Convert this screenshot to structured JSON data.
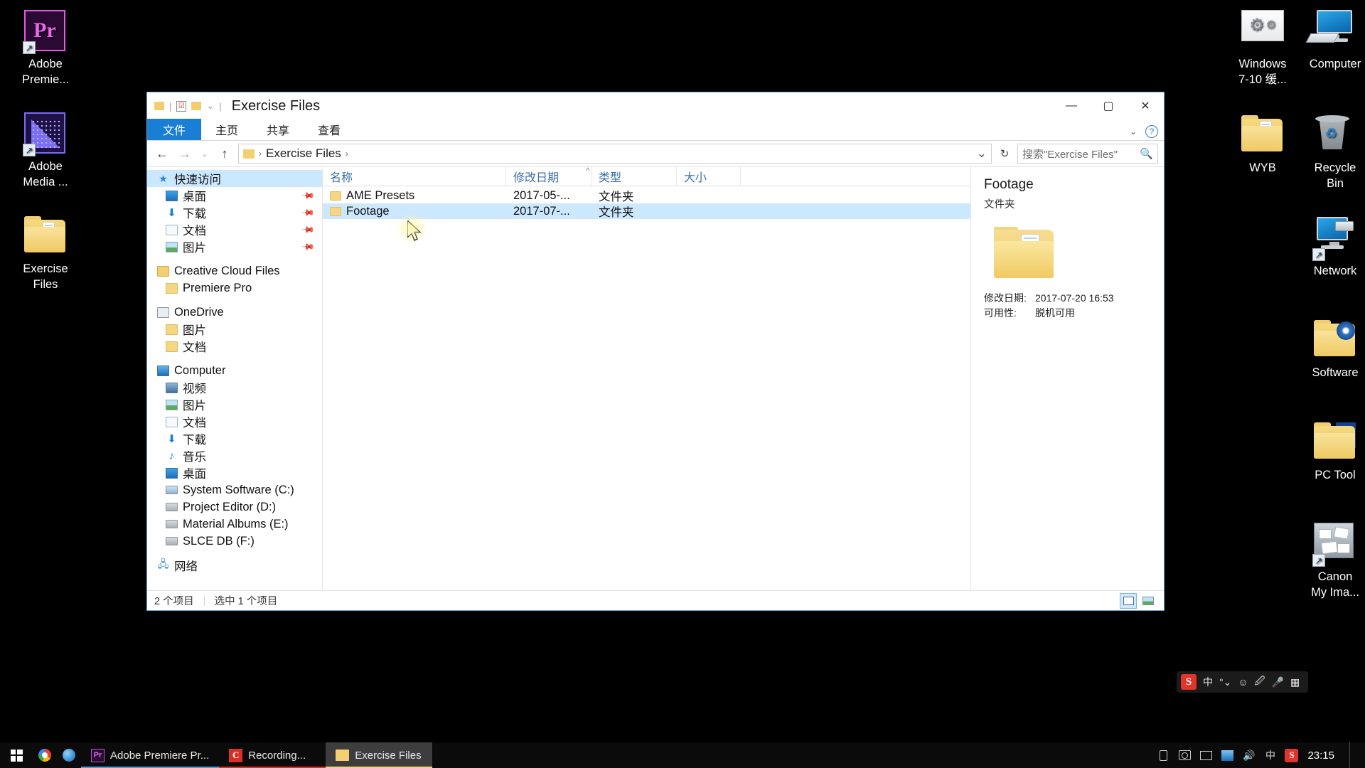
{
  "desktop": {
    "icons_left": [
      {
        "label": "Adobe\nPremie...",
        "icon": "adobe-premiere-icon",
        "shortcut": true
      },
      {
        "label": "Adobe\nMedia ...",
        "icon": "adobe-media-encoder-icon",
        "shortcut": true
      },
      {
        "label": "Exercise\nFiles",
        "icon": "folder-icon",
        "shortcut": false
      }
    ],
    "icons_right": [
      {
        "label": "Windows\n7-10 缓...",
        "icon": "gears-icon",
        "shortcut": false
      },
      {
        "label": "Computer",
        "icon": "computer-icon",
        "shortcut": false
      },
      {
        "label": "WYB",
        "icon": "folder-icon",
        "shortcut": false
      },
      {
        "label": "Recycle\nBin",
        "icon": "recycle-bin-icon",
        "shortcut": false
      },
      {
        "label": "Network",
        "icon": "network-icon",
        "shortcut": true
      },
      {
        "label": "Software",
        "icon": "folder-disc-icon",
        "shortcut": false
      },
      {
        "label": "PC Tool",
        "icon": "folder-s-icon",
        "shortcut": false
      },
      {
        "label": "Canon\nMy Ima...",
        "icon": "canon-my-image-garden-icon",
        "shortcut": true
      }
    ]
  },
  "explorer": {
    "window_title": "Exercise Files",
    "quick_access_toolbar": [
      "folder-icon",
      "properties-icon",
      "new-folder-icon",
      "customize-chevron-icon"
    ],
    "window_buttons": {
      "minimize": "—",
      "maximize": "▢",
      "close": "✕"
    },
    "ribbon_tabs": [
      {
        "label": "文件",
        "active": true
      },
      {
        "label": "主页",
        "active": false
      },
      {
        "label": "共享",
        "active": false
      },
      {
        "label": "查看",
        "active": false
      }
    ],
    "ribbon_help": "?",
    "address": {
      "back": "←",
      "forward": "→",
      "recent": "⌄",
      "up": "↑",
      "crumbs": [
        "Exercise Files"
      ],
      "crumb_sep": "›",
      "dropdown": "⌄",
      "refresh": "↻"
    },
    "search": {
      "placeholder": "搜索\"Exercise Files\"",
      "icon": "search-icon"
    },
    "nav_pane": {
      "groups": [
        {
          "header": {
            "label": "快速访问",
            "icon": "star-icon",
            "selected": true
          },
          "items": [
            {
              "label": "桌面",
              "icon": "desktop-icon",
              "pinned": true
            },
            {
              "label": "下载",
              "icon": "download-icon",
              "pinned": true
            },
            {
              "label": "文档",
              "icon": "document-icon",
              "pinned": true
            },
            {
              "label": "图片",
              "icon": "pictures-icon",
              "pinned": true
            }
          ]
        },
        {
          "header": {
            "label": "Creative Cloud Files",
            "icon": "creative-cloud-icon",
            "selected": false
          },
          "items": [
            {
              "label": "Premiere Pro",
              "icon": "folder-icon",
              "pinned": false
            }
          ]
        },
        {
          "header": {
            "label": "OneDrive",
            "icon": "onedrive-icon",
            "selected": false
          },
          "items": [
            {
              "label": "图片",
              "icon": "folder-icon",
              "pinned": false
            },
            {
              "label": "文档",
              "icon": "folder-icon",
              "pinned": false
            }
          ]
        },
        {
          "header": {
            "label": "Computer",
            "icon": "computer-icon",
            "selected": false
          },
          "items": [
            {
              "label": "视频",
              "icon": "videos-icon",
              "pinned": false
            },
            {
              "label": "图片",
              "icon": "pictures-icon",
              "pinned": false
            },
            {
              "label": "文档",
              "icon": "document-icon",
              "pinned": false
            },
            {
              "label": "下载",
              "icon": "download-icon",
              "pinned": false
            },
            {
              "label": "音乐",
              "icon": "music-icon",
              "pinned": false
            },
            {
              "label": "桌面",
              "icon": "desktop-icon",
              "pinned": false
            },
            {
              "label": "System Software (C:)",
              "icon": "system-drive-icon",
              "pinned": false
            },
            {
              "label": "Project Editor (D:)",
              "icon": "drive-icon",
              "pinned": false
            },
            {
              "label": "Material Albums (E:)",
              "icon": "drive-icon",
              "pinned": false
            },
            {
              "label": "SLCE DB (F:)",
              "icon": "drive-icon",
              "pinned": false
            }
          ]
        },
        {
          "header": {
            "label": "网络",
            "icon": "network-icon",
            "selected": false
          },
          "items": []
        }
      ]
    },
    "columns": [
      {
        "key": "name",
        "label": "名称",
        "sorted": true
      },
      {
        "key": "date",
        "label": "修改日期",
        "sorted": false
      },
      {
        "key": "type",
        "label": "类型",
        "sorted": false
      },
      {
        "key": "size",
        "label": "大小",
        "sorted": false
      }
    ],
    "files": [
      {
        "name": "AME Presets",
        "date": "2017-05-...",
        "type": "文件夹",
        "size": "",
        "selected": false
      },
      {
        "name": "Footage",
        "date": "2017-07-...",
        "type": "文件夹",
        "size": "",
        "selected": true
      }
    ],
    "preview": {
      "title": "Footage",
      "subtitle": "文件夹",
      "icon": "folder-icon",
      "meta": [
        {
          "key": "修改日期:",
          "value": "2017-07-20 16:53"
        },
        {
          "key": "可用性:",
          "value": "脱机可用"
        }
      ]
    },
    "status": {
      "item_count": "2 个项目",
      "selection": "选中 1 个项目",
      "views": [
        {
          "name": "details-view",
          "active": true
        },
        {
          "name": "large-icons-view",
          "active": false
        }
      ]
    }
  },
  "ime_bar": {
    "logo": "S",
    "items": [
      "中",
      "°⌄",
      "☺",
      "🖉",
      "🎤",
      "▦"
    ]
  },
  "taskbar": {
    "start": "windows-logo",
    "quick_launch": [
      "chrome-icon",
      "ie-icon"
    ],
    "items": [
      {
        "label": "Adobe Premiere Pr...",
        "icon": "premiere-icon",
        "active": false,
        "accent": "#4a9fe0"
      },
      {
        "label": "Recording...",
        "icon": "camtasia-icon",
        "active": false,
        "accent": "#d93025"
      },
      {
        "label": "Exercise Files",
        "icon": "folder-icon",
        "active": true,
        "accent": "#f3d070"
      }
    ],
    "tray": [
      "usb-icon",
      "camera-icon",
      "network-monitor-icon",
      "bluetooth-icon",
      "volume-icon",
      "ime-cn-icon",
      "sogou-icon"
    ],
    "clock": "23:15"
  },
  "colors": {
    "accent_blue": "#1a7fd4",
    "selection_blue": "#cce8ff",
    "folder_yellow": "#f3d070",
    "taskbar_bg": "#0b0b0b"
  }
}
